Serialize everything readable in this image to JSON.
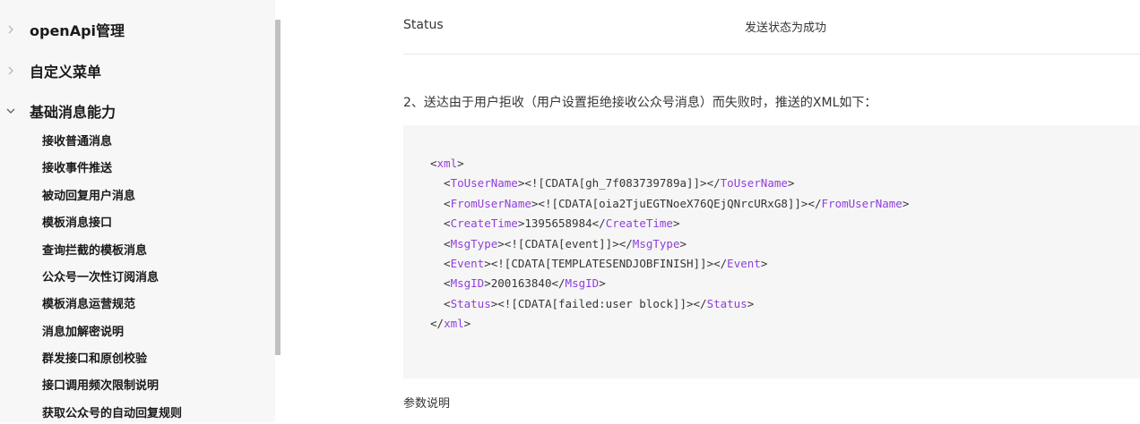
{
  "sidebar": {
    "groups": [
      {
        "label": "openApi管理",
        "expanded": false
      },
      {
        "label": "自定义菜单",
        "expanded": false
      },
      {
        "label": "基础消息能力",
        "expanded": true
      }
    ],
    "items": [
      "接收普通消息",
      "接收事件推送",
      "被动回复用户消息",
      "模板消息接口",
      "查询拦截的模板消息",
      "公众号一次性订阅消息",
      "模板消息运营规范",
      "消息加解密说明",
      "群发接口和原创校验",
      "接口调用频次限制说明",
      "获取公众号的自动回复规则"
    ]
  },
  "content": {
    "status_key": "Status",
    "status_value": "发送状态为成功",
    "paragraph": "2、送达由于用户拒收（用户设置拒绝接收公众号消息）而失败时，推送的XML如下：",
    "code": {
      "root_tag": "xml",
      "lines": [
        {
          "tag": "ToUserName",
          "value": "<![CDATA[gh_7f083739789a]]>"
        },
        {
          "tag": "FromUserName",
          "value": "<![CDATA[oia2TjuEGTNoeX76QEjQNrcURxG8]]>"
        },
        {
          "tag": "CreateTime",
          "value": "1395658984"
        },
        {
          "tag": "MsgType",
          "value": "<![CDATA[event]]>"
        },
        {
          "tag": "Event",
          "value": "<![CDATA[TEMPLATESENDJOBFINISH]]>"
        },
        {
          "tag": "MsgID",
          "value": "200163840"
        },
        {
          "tag": "Status",
          "value": "<![CDATA[failed:user block]]>"
        }
      ]
    },
    "param_title": "参数说明"
  },
  "colors": {
    "tag": "#8f3fdc",
    "code_bg": "#f6f6f6",
    "sidebar_bg": "#f7f7f7"
  }
}
